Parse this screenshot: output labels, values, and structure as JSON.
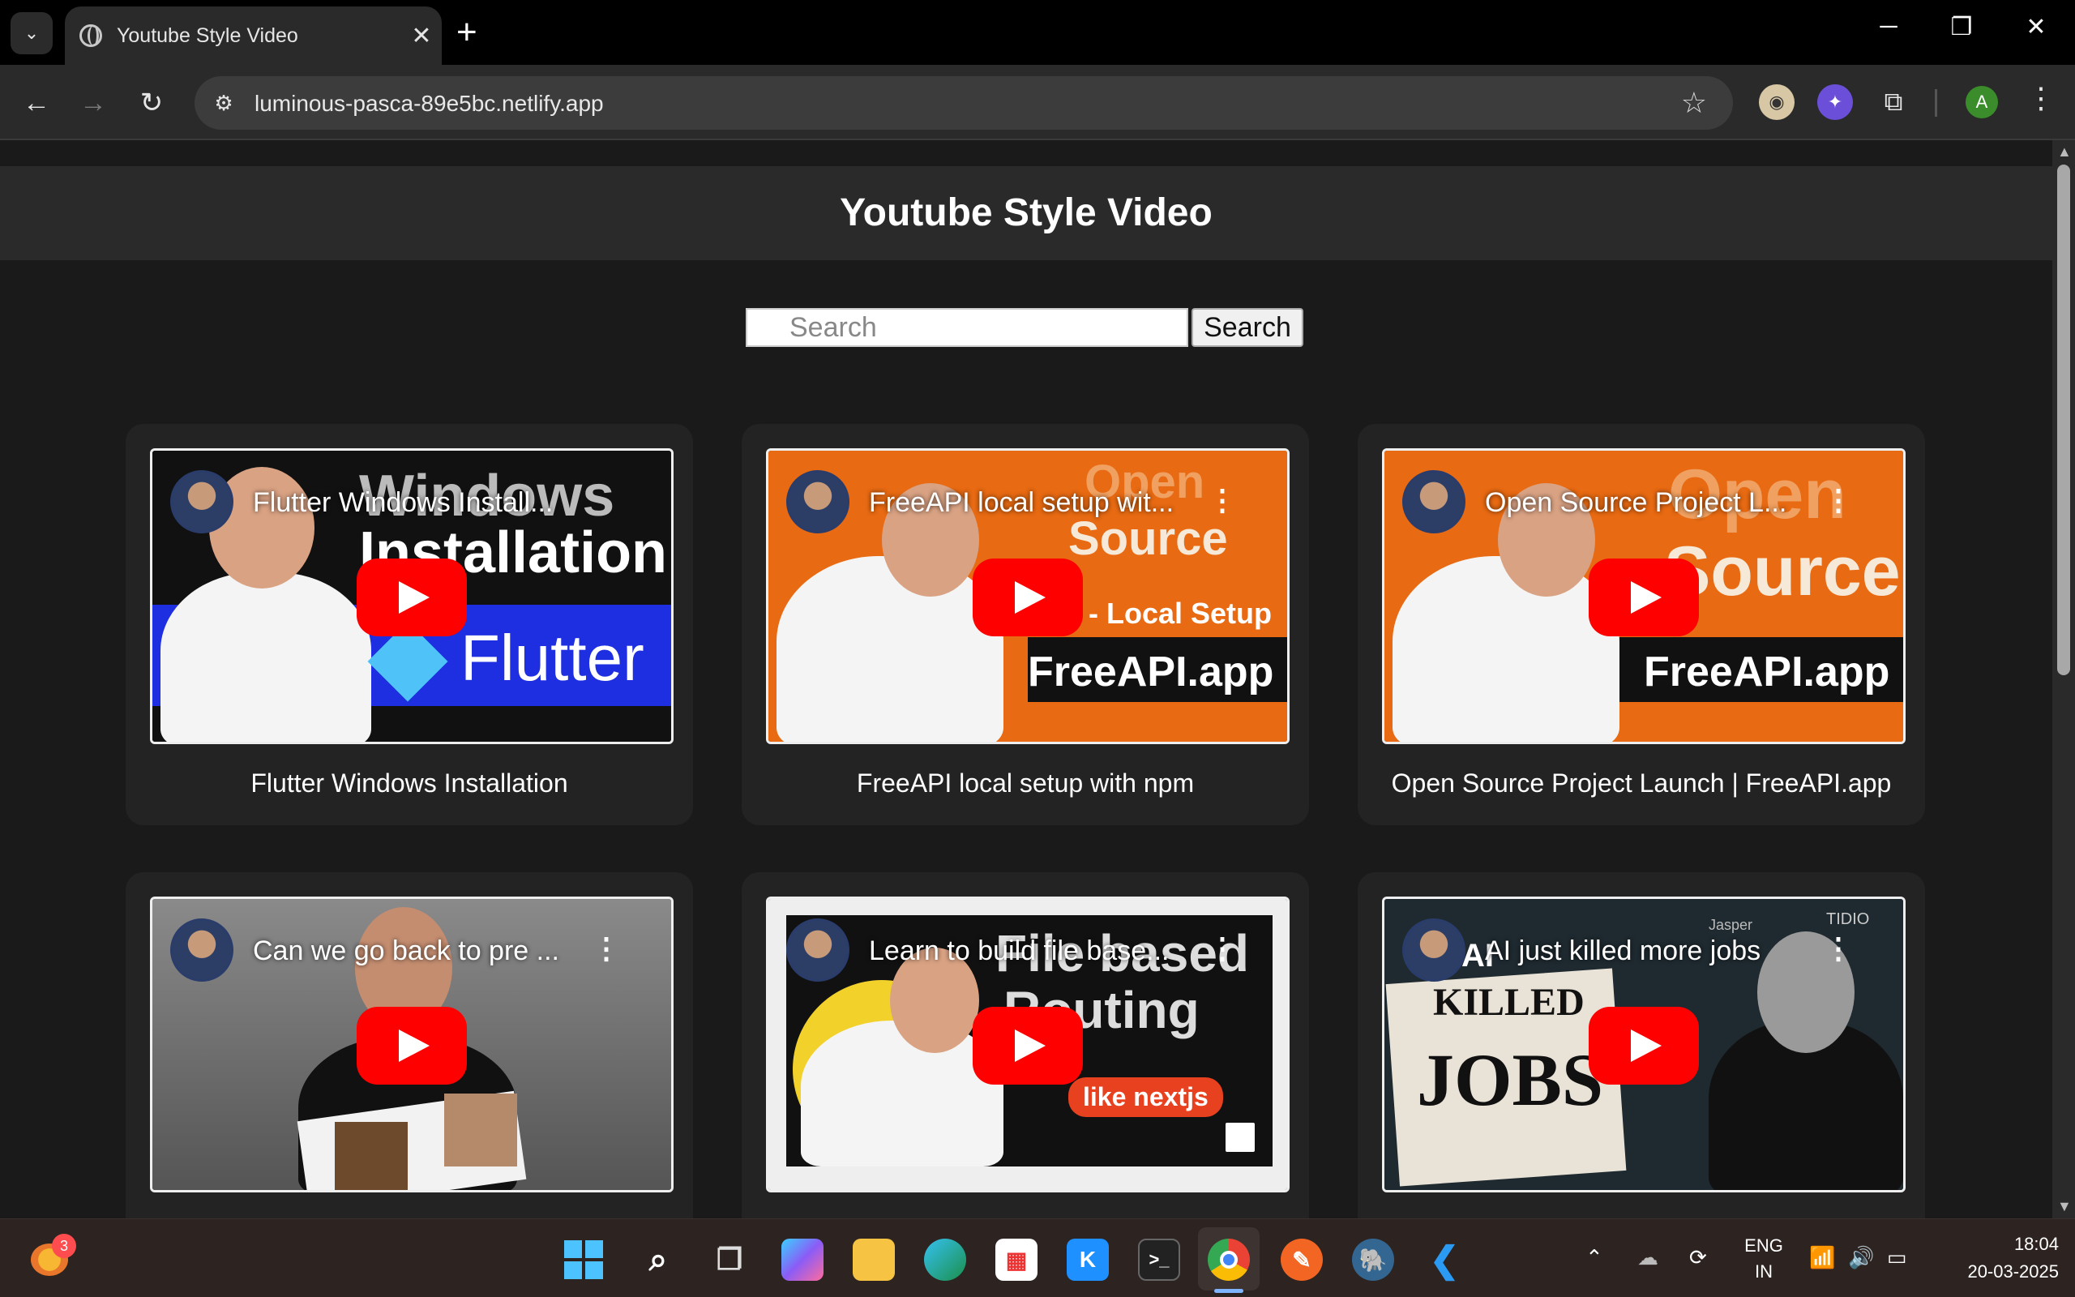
{
  "browser": {
    "tab_title": "Youtube Style Video",
    "url": "luminous-pasca-89e5bc.netlify.app",
    "profile_initial": "A"
  },
  "page": {
    "title": "Youtube Style Video",
    "search_placeholder": "Search",
    "search_button": "Search"
  },
  "videos": [
    {
      "overlay_title": "Flutter Windows Install...",
      "caption": "Flutter Windows Installation",
      "thumb_text": [
        "Windows",
        "Installation",
        "Flutter"
      ]
    },
    {
      "overlay_title": "FreeAPI local setup wit...",
      "caption": "FreeAPI local setup with npm",
      "thumb_text": [
        "Open",
        "Source",
        "- Local Setup",
        "FreeAPI.app"
      ]
    },
    {
      "overlay_title": "Open Source Project L...",
      "caption": "Open Source Project Launch | FreeAPI.app",
      "thumb_text": [
        "Open",
        "Source",
        "FreeAPI.app"
      ]
    },
    {
      "overlay_title": "Can we go back to pre ...",
      "caption": "",
      "thumb_text": []
    },
    {
      "overlay_title": "Learn to build file base...",
      "caption": "",
      "thumb_text": [
        "File based",
        "Routing",
        "like nextjs"
      ]
    },
    {
      "overlay_title": "AI just killed more jobs",
      "caption": "",
      "thumb_text": [
        "AI",
        "KILLED",
        "JOBS",
        "TIDIO",
        "Jasper"
      ]
    }
  ],
  "taskbar": {
    "notification_count": "3",
    "language_line1": "ENG",
    "language_line2": "IN",
    "time": "18:04",
    "date": "20-03-2025"
  },
  "colors": {
    "play_button": "#ff0000",
    "page_bg": "#1a1a1a",
    "card_bg": "#232323",
    "header_bg": "#2a2a2a"
  }
}
